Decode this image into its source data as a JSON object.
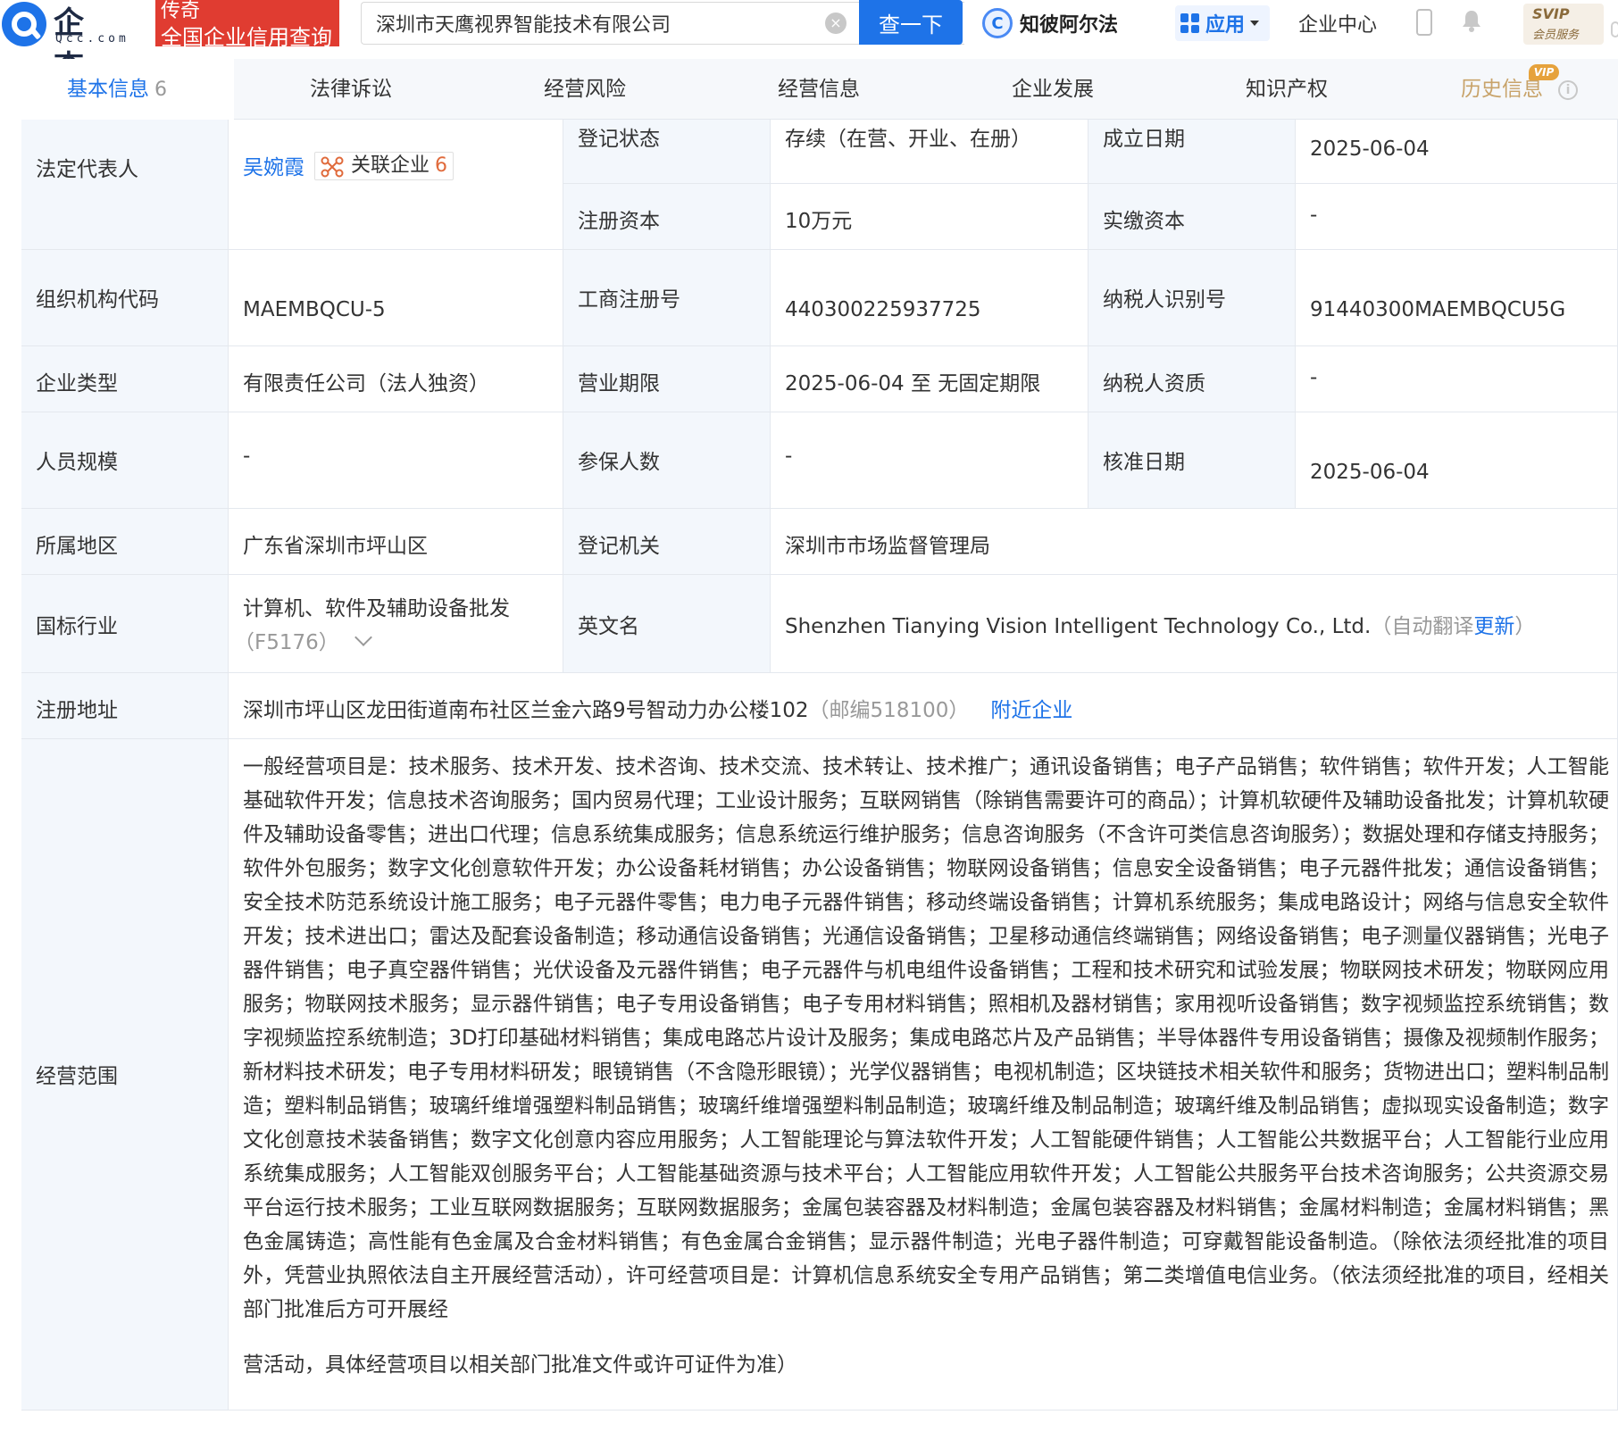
{
  "header": {
    "logo_cn": "企查查",
    "logo_en": "Qcc.com",
    "badge_line1": "传奇",
    "badge_line2": "全国企业信用查询",
    "search_value": "深圳市天鹰视界智能技术有限公司",
    "search_button": "查一下",
    "ai_label": "知彼阿尔法",
    "app_label": "应用",
    "enterprise_center": "企业中心",
    "svip_title": "SVIP",
    "svip_sub": "会员服务"
  },
  "tabs": [
    {
      "label": "基本信息",
      "count": "6"
    },
    {
      "label": "法律诉讼"
    },
    {
      "label": "经营风险"
    },
    {
      "label": "经营信息"
    },
    {
      "label": "企业发展"
    },
    {
      "label": "知识产权"
    },
    {
      "label": "历史信息",
      "badge": "VIP"
    }
  ],
  "info": {
    "legal_rep_label": "法定代表人",
    "legal_rep_name": "吴婉霞",
    "related_label": "关联企业",
    "related_count": "6",
    "reg_status_label": "登记状态",
    "reg_status": "存续（在营、开业、在册）",
    "found_date_label": "成立日期",
    "found_date": "2025-06-04",
    "reg_capital_label": "注册资本",
    "reg_capital": "10万元",
    "paid_capital_label": "实缴资本",
    "paid_capital": "-",
    "org_code_label": "组织机构代码",
    "org_code": "MAEMBQCU-5",
    "biz_reg_no_label": "工商注册号",
    "biz_reg_no": "440300225937725",
    "taxpayer_id_label": "纳税人识别号",
    "taxpayer_id": "91440300MAEMBQCU5G",
    "ent_type_label": "企业类型",
    "ent_type": "有限责任公司（法人独资）",
    "biz_term_label": "营业期限",
    "biz_term": "2025-06-04 至 无固定期限",
    "tax_qual_label": "纳税人资质",
    "tax_qual": "-",
    "staff_label": "人员规模",
    "staff": "-",
    "insured_label": "参保人数",
    "insured": "-",
    "approve_date_label": "核准日期",
    "approve_date": "2025-06-04",
    "region_label": "所属地区",
    "region": "广东省深圳市坪山区",
    "authority_label": "登记机关",
    "authority": "深圳市市场监督管理局",
    "industry_label": "国标行业",
    "industry_line1": "计算机、软件及辅助设备批发",
    "industry_line2": "（F5176）",
    "en_name_label": "英文名",
    "en_name": "Shenzhen Tianying Vision Intelligent Technology Co., Ltd.",
    "en_auto_open": "（自动翻译",
    "en_update": "更新",
    "en_auto_close": "）",
    "address_label": "注册地址",
    "address": "深圳市坪山区龙田街道南布社区兰金六路9号智动力办公楼102",
    "postcode": "（邮编518100）",
    "nearby": "附近企业",
    "scope_label": "经营范围",
    "scope_p1": "一般经营项目是：技术服务、技术开发、技术咨询、技术交流、技术转让、技术推广；通讯设备销售；电子产品销售；软件销售；软件开发；人工智能基础软件开发；信息技术咨询服务；国内贸易代理；工业设计服务；互联网销售（除销售需要许可的商品）；计算机软硬件及辅助设备批发；计算机软硬件及辅助设备零售；进出口代理；信息系统集成服务；信息系统运行维护服务；信息咨询服务（不含许可类信息咨询服务）；数据处理和存储支持服务；软件外包服务；数字文化创意软件开发；办公设备耗材销售；办公设备销售；物联网设备销售；信息安全设备销售；电子元器件批发；通信设备销售；安全技术防范系统设计施工服务；电子元器件零售；电力电子元器件销售；移动终端设备销售；计算机系统服务；集成电路设计；网络与信息安全软件开发；技术进出口；雷达及配套设备制造；移动通信设备销售；光通信设备销售；卫星移动通信终端销售；网络设备销售；电子测量仪器销售；光电子器件销售；电子真空器件销售；光伏设备及元器件销售；电子元器件与机电组件设备销售；工程和技术研究和试验发展；物联网技术研发；物联网应用服务；物联网技术服务；显示器件销售；电子专用设备销售；电子专用材料销售；照相机及器材销售；家用视听设备销售；数字视频监控系统销售；数字视频监控系统制造；3D打印基础材料销售；集成电路芯片设计及服务；集成电路芯片及产品销售；半导体器件专用设备销售；摄像及视频制作服务；新材料技术研发；电子专用材料研发；眼镜销售（不含隐形眼镜）；光学仪器销售；电视机制造；区块链技术相关软件和服务；货物进出口；塑料制品制造；塑料制品销售；玻璃纤维增强塑料制品销售；玻璃纤维增强塑料制品制造；玻璃纤维及制品制造；玻璃纤维及制品销售；虚拟现实设备制造；数字文化创意技术装备销售；数字文化创意内容应用服务；人工智能理论与算法软件开发；人工智能硬件销售；人工智能公共数据平台；人工智能行业应用系统集成服务；人工智能双创服务平台；人工智能基础资源与技术平台；人工智能应用软件开发；人工智能公共服务平台技术咨询服务；公共资源交易平台运行技术服务；工业互联网数据服务；互联网数据服务；金属包装容器及材料制造；金属包装容器及材料销售；金属材料制造；金属材料销售；黑色金属铸造；高性能有色金属及合金材料销售；有色金属合金销售；显示器件制造；光电子器件制造；可穿戴智能设备制造。（除依法须经批准的项目外，凭营业执照依法自主开展经营活动），许可经营项目是：计算机信息系统安全专用产品销售；第二类增值电信业务。（依法须经批准的项目，经相关部门批准后方可开展经",
    "scope_p2": "营活动，具体经营项目以相关部门批准文件或许可证件为准）"
  },
  "colors": {
    "brand_blue": "#1e73e8",
    "label_bg": "#f3f7fc",
    "border": "#e4e8ee",
    "logo_red": "#e03c31"
  }
}
